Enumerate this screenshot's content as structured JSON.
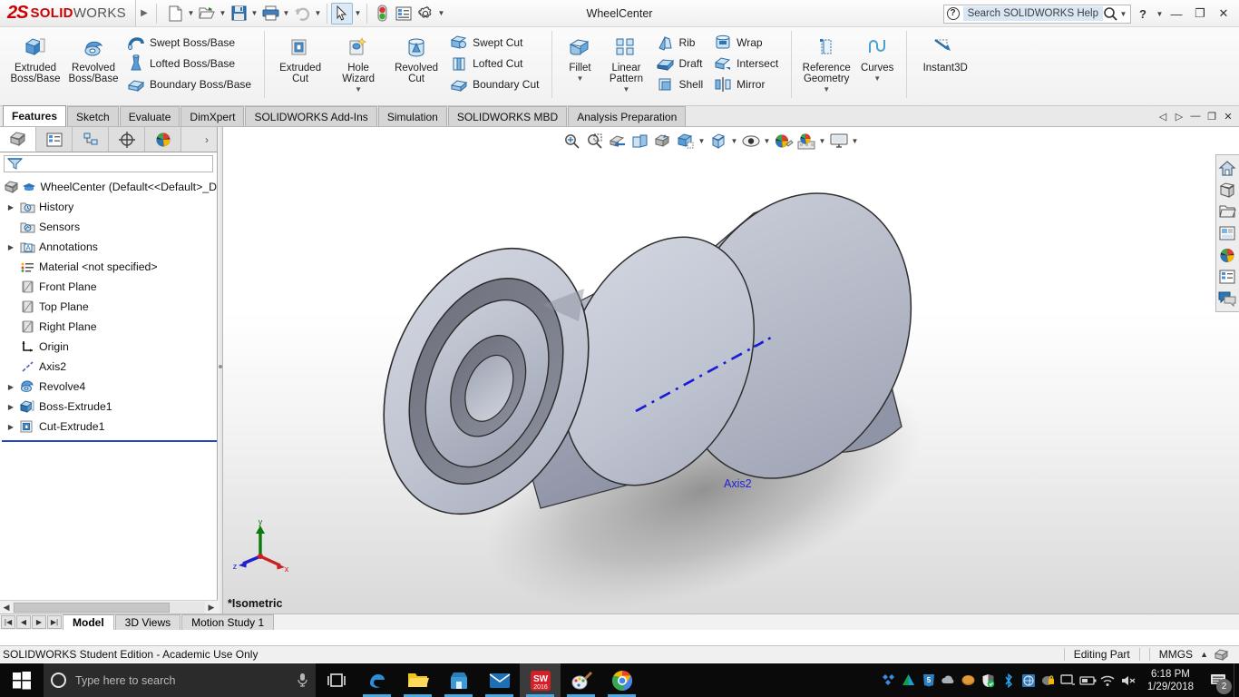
{
  "window": {
    "title": "WheelCenter",
    "logo_mark": "2S",
    "logo_solid": "SOLID",
    "logo_works": "WORKS",
    "expand_icon": "chevron-right-icon"
  },
  "quick_access": [
    {
      "name": "new-document",
      "icon": "new-doc-icon",
      "has_caret": true
    },
    {
      "name": "open-document",
      "icon": "open-folder-icon",
      "has_caret": true
    },
    {
      "name": "save-document",
      "icon": "save-disk-icon",
      "has_caret": true
    },
    {
      "name": "print-document",
      "icon": "printer-icon",
      "has_caret": true
    },
    {
      "name": "undo",
      "icon": "undo-arrow-icon",
      "has_caret": true
    },
    {
      "name": "select",
      "icon": "cursor-arrow-icon",
      "has_caret": true,
      "selected": true
    },
    {
      "name": "rebuild",
      "icon": "traffic-light-icon",
      "has_caret": false
    },
    {
      "name": "file-properties",
      "icon": "properties-list-icon",
      "has_caret": false
    },
    {
      "name": "options",
      "icon": "gear-icon",
      "has_caret": true
    }
  ],
  "help": {
    "placeholder": "Search SOLIDWORKS Help",
    "search_icon": "magnifier-icon",
    "help_icon": "question-mark-icon"
  },
  "window_controls": {
    "help": "?",
    "minimize": "—",
    "restore": "❐",
    "close": "✕"
  },
  "ribbon": {
    "groups": [
      {
        "name": "boss-base-group",
        "big": [
          {
            "label": "Extruded\nBoss/Base",
            "icon": "extruded-boss-icon",
            "dropdown": false
          },
          {
            "label": "Revolved\nBoss/Base",
            "icon": "revolved-boss-icon",
            "dropdown": false
          }
        ],
        "small": [
          {
            "label": "Swept Boss/Base",
            "icon": "swept-boss-icon"
          },
          {
            "label": "Lofted Boss/Base",
            "icon": "lofted-boss-icon"
          },
          {
            "label": "Boundary Boss/Base",
            "icon": "boundary-boss-icon"
          }
        ]
      },
      {
        "name": "cut-group",
        "big": [
          {
            "label": "Extruded\nCut",
            "icon": "extruded-cut-icon",
            "dropdown": false
          },
          {
            "label": "Hole\nWizard",
            "icon": "hole-wizard-icon",
            "dropdown": true
          },
          {
            "label": "Revolved\nCut",
            "icon": "revolved-cut-icon",
            "dropdown": false
          }
        ],
        "small": [
          {
            "label": "Swept Cut",
            "icon": "swept-cut-icon"
          },
          {
            "label": "Lofted Cut",
            "icon": "lofted-cut-icon"
          },
          {
            "label": "Boundary Cut",
            "icon": "boundary-cut-icon"
          }
        ]
      },
      {
        "name": "feature-group",
        "big": [
          {
            "label": "Fillet",
            "icon": "fillet-icon",
            "dropdown": true
          },
          {
            "label": "Linear\nPattern",
            "icon": "linear-pattern-icon",
            "dropdown": true
          }
        ],
        "small": [
          {
            "label": "Rib",
            "icon": "rib-icon"
          },
          {
            "label": "Draft",
            "icon": "draft-icon"
          },
          {
            "label": "Shell",
            "icon": "shell-icon"
          }
        ],
        "small2": [
          {
            "label": "Wrap",
            "icon": "wrap-icon"
          },
          {
            "label": "Intersect",
            "icon": "intersect-icon"
          },
          {
            "label": "Mirror",
            "icon": "mirror-icon"
          }
        ]
      },
      {
        "name": "reference-group",
        "big": [
          {
            "label": "Reference\nGeometry",
            "icon": "reference-geometry-icon",
            "dropdown": true
          },
          {
            "label": "Curves",
            "icon": "curves-icon",
            "dropdown": true
          }
        ]
      },
      {
        "name": "instant3d-group",
        "big": [
          {
            "label": "Instant3D",
            "icon": "instant3d-icon",
            "dropdown": false
          }
        ]
      }
    ]
  },
  "command_tabs": [
    {
      "label": "Features",
      "active": true
    },
    {
      "label": "Sketch",
      "active": false
    },
    {
      "label": "Evaluate",
      "active": false
    },
    {
      "label": "DimXpert",
      "active": false
    },
    {
      "label": "SOLIDWORKS Add-Ins",
      "active": false
    },
    {
      "label": "Simulation",
      "active": false
    },
    {
      "label": "SOLIDWORKS MBD",
      "active": false
    },
    {
      "label": "Analysis Preparation",
      "active": false
    }
  ],
  "doc_controls": [
    {
      "name": "pin-left",
      "glyph": "◁"
    },
    {
      "name": "pin-right",
      "glyph": "▷"
    },
    {
      "name": "doc-minimize",
      "glyph": "—"
    },
    {
      "name": "doc-restore",
      "glyph": "❐"
    },
    {
      "name": "doc-close",
      "glyph": "✕"
    }
  ],
  "feature_panel": {
    "tabs": [
      {
        "name": "feature-manager-tab",
        "icon": "feature-tree-icon",
        "active": true
      },
      {
        "name": "property-manager-tab",
        "icon": "property-list-icon",
        "active": false
      },
      {
        "name": "configuration-manager-tab",
        "icon": "configuration-icon",
        "active": false
      },
      {
        "name": "dimxpert-manager-tab",
        "icon": "dimxpert-icon",
        "active": false
      },
      {
        "name": "display-manager-tab",
        "icon": "display-sphere-icon",
        "active": false
      }
    ],
    "more_glyph": "›",
    "filter_icon": "filter-funnel-icon",
    "filter_value": "",
    "tree": [
      {
        "label": "WheelCenter  (Default<<Default>_D",
        "icon": "part-icon",
        "extra_icon": "rebuild-cap-icon",
        "indent": 0,
        "arrow": false,
        "root": true
      },
      {
        "label": "History",
        "icon": "history-folder-icon",
        "indent": 1,
        "arrow": true
      },
      {
        "label": "Sensors",
        "icon": "sensors-folder-icon",
        "indent": 1,
        "arrow": false
      },
      {
        "label": "Annotations",
        "icon": "annotations-icon",
        "indent": 1,
        "arrow": true
      },
      {
        "label": "Material <not specified>",
        "icon": "material-icon",
        "indent": 1,
        "arrow": false
      },
      {
        "label": "Front Plane",
        "icon": "plane-icon",
        "indent": 1,
        "arrow": false
      },
      {
        "label": "Top Plane",
        "icon": "plane-icon",
        "indent": 1,
        "arrow": false
      },
      {
        "label": "Right Plane",
        "icon": "plane-icon",
        "indent": 1,
        "arrow": false
      },
      {
        "label": "Origin",
        "icon": "origin-icon",
        "indent": 1,
        "arrow": false
      },
      {
        "label": "Axis2",
        "icon": "axis-icon",
        "indent": 1,
        "arrow": false
      },
      {
        "label": "Revolve4",
        "icon": "revolve-feature-icon",
        "indent": 1,
        "arrow": true
      },
      {
        "label": "Boss-Extrude1",
        "icon": "boss-extrude-feature-icon",
        "indent": 1,
        "arrow": true
      },
      {
        "label": "Cut-Extrude1",
        "icon": "cut-extrude-feature-icon",
        "indent": 1,
        "arrow": true
      }
    ]
  },
  "view_toolbar": [
    {
      "name": "zoom-to-fit-button",
      "icon": "zoom-fit-icon",
      "caret": false
    },
    {
      "name": "zoom-to-area-button",
      "icon": "zoom-area-icon",
      "caret": false
    },
    {
      "name": "previous-view-button",
      "icon": "previous-view-icon",
      "caret": false
    },
    {
      "name": "section-view-button",
      "icon": "section-view-icon",
      "caret": false
    },
    {
      "name": "view-orientation-button",
      "icon": "view-orientation-icon",
      "caret": false
    },
    {
      "name": "display-style-button",
      "icon": "display-style-icon",
      "caret": true
    },
    {
      "name": "hide-show-items-button",
      "icon": "hide-show-cube-icon",
      "caret": true
    },
    {
      "name": "view-settings-button",
      "icon": "view-settings-eye-icon",
      "caret": true
    },
    {
      "name": "apply-scene-button",
      "icon": "apply-scene-icon",
      "caret": false
    },
    {
      "name": "appearances-button",
      "icon": "appearances-icon",
      "caret": true
    },
    {
      "name": "viewport-button",
      "icon": "viewport-monitor-icon",
      "caret": true
    }
  ],
  "right_toolbar": [
    {
      "name": "home-button",
      "icon": "home-icon"
    },
    {
      "name": "design-library-button",
      "icon": "design-library-icon"
    },
    {
      "name": "file-explorer-button",
      "icon": "file-explorer-folder-icon"
    },
    {
      "name": "view-palette-button",
      "icon": "view-palette-icon"
    },
    {
      "name": "appearances-scenes-button",
      "icon": "appearances-sphere-icon"
    },
    {
      "name": "custom-properties-button",
      "icon": "custom-properties-icon"
    },
    {
      "name": "solidworks-forum-button",
      "icon": "forum-bubbles-icon"
    }
  ],
  "graphics": {
    "axis_label": "Axis2",
    "view_label": "*Isometric",
    "triad": {
      "x": "x",
      "y": "y",
      "z": "z"
    }
  },
  "bottom_tabs": {
    "nav": [
      "|◀",
      "◀",
      "▶",
      "▶|"
    ],
    "tabs": [
      {
        "label": "Model",
        "active": true
      },
      {
        "label": "3D Views",
        "active": false
      },
      {
        "label": "Motion Study 1",
        "active": false
      }
    ]
  },
  "status_bar": {
    "license": "SOLIDWORKS Student Edition - Academic Use Only",
    "mode": "Editing Part",
    "units": "MMGS",
    "units_caret": "▲",
    "overlay_icon": "part-overlay-icon"
  },
  "taskbar": {
    "start_icon": "windows-start-icon",
    "search_placeholder": "Type here to search",
    "cortana_icon": "cortana-circle-icon",
    "mic_icon": "microphone-icon",
    "taskview_icon": "task-view-icon",
    "pinned": [
      {
        "name": "edge-icon",
        "label": "e"
      },
      {
        "name": "file-explorer-icon",
        "label": ""
      },
      {
        "name": "store-icon",
        "label": ""
      },
      {
        "name": "mail-icon",
        "label": ""
      },
      {
        "name": "solidworks-2016-icon",
        "label": "SW",
        "sub": "2016",
        "active": true,
        "running": true
      },
      {
        "name": "paint-icon",
        "label": "",
        "running": true
      },
      {
        "name": "chrome-icon",
        "label": "",
        "running": true
      }
    ],
    "tray": [
      {
        "name": "dropbox-tray-icon"
      },
      {
        "name": "autodesk-tray-icon"
      },
      {
        "name": "html5-tray-icon"
      },
      {
        "name": "onedrive-tray-icon"
      },
      {
        "name": "disc-tray-icon"
      },
      {
        "name": "defender-tray-icon"
      },
      {
        "name": "bluetooth-tray-icon"
      },
      {
        "name": "network-share-tray-icon"
      },
      {
        "name": "security-tray-icon"
      },
      {
        "name": "display-tray-icon"
      },
      {
        "name": "battery-tray-icon"
      },
      {
        "name": "wifi-tray-icon"
      },
      {
        "name": "volume-muted-tray-icon"
      }
    ],
    "clock_time": "6:18 PM",
    "clock_date": "1/29/2018",
    "notification_count": "2"
  }
}
